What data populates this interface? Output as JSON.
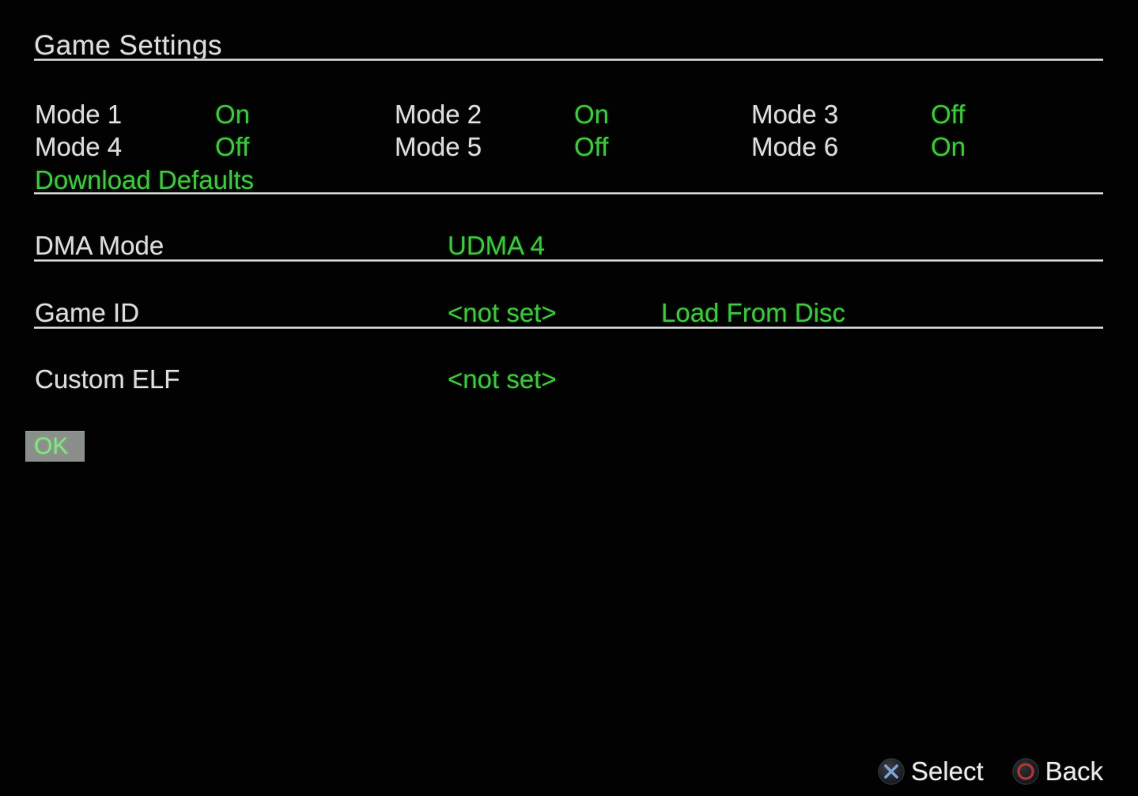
{
  "screen": {
    "title": "Game Settings",
    "background_color": "#020202",
    "label_color": "#d8d8d8",
    "value_color": "#3fc23f"
  },
  "modes": {
    "rows": [
      {
        "cells": [
          {
            "label": "Mode 1",
            "value": "On"
          },
          {
            "label": "Mode 2",
            "value": "On"
          },
          {
            "label": "Mode 3",
            "value": "Off"
          }
        ]
      },
      {
        "cells": [
          {
            "label": "Mode 4",
            "value": "Off"
          },
          {
            "label": "Mode 5",
            "value": "Off"
          },
          {
            "label": "Mode 6",
            "value": "On"
          }
        ]
      }
    ],
    "download_defaults": "Download Defaults"
  },
  "dma": {
    "label": "DMA Mode",
    "value": "UDMA 4"
  },
  "game_id": {
    "label": "Game ID",
    "value": "<not set>",
    "action": "Load From Disc"
  },
  "custom_elf": {
    "label": "Custom ELF",
    "value": "<not set>"
  },
  "ok_button": {
    "label": "OK",
    "highlight_color": "#8b8f8b",
    "text_color": "#86e186"
  },
  "hints": [
    {
      "icon": "ps-cross-button-icon",
      "label": "Select",
      "icon_color": "#6d8fc4"
    },
    {
      "icon": "ps-circle-button-icon",
      "label": "Back",
      "icon_color": "#a33131"
    }
  ]
}
